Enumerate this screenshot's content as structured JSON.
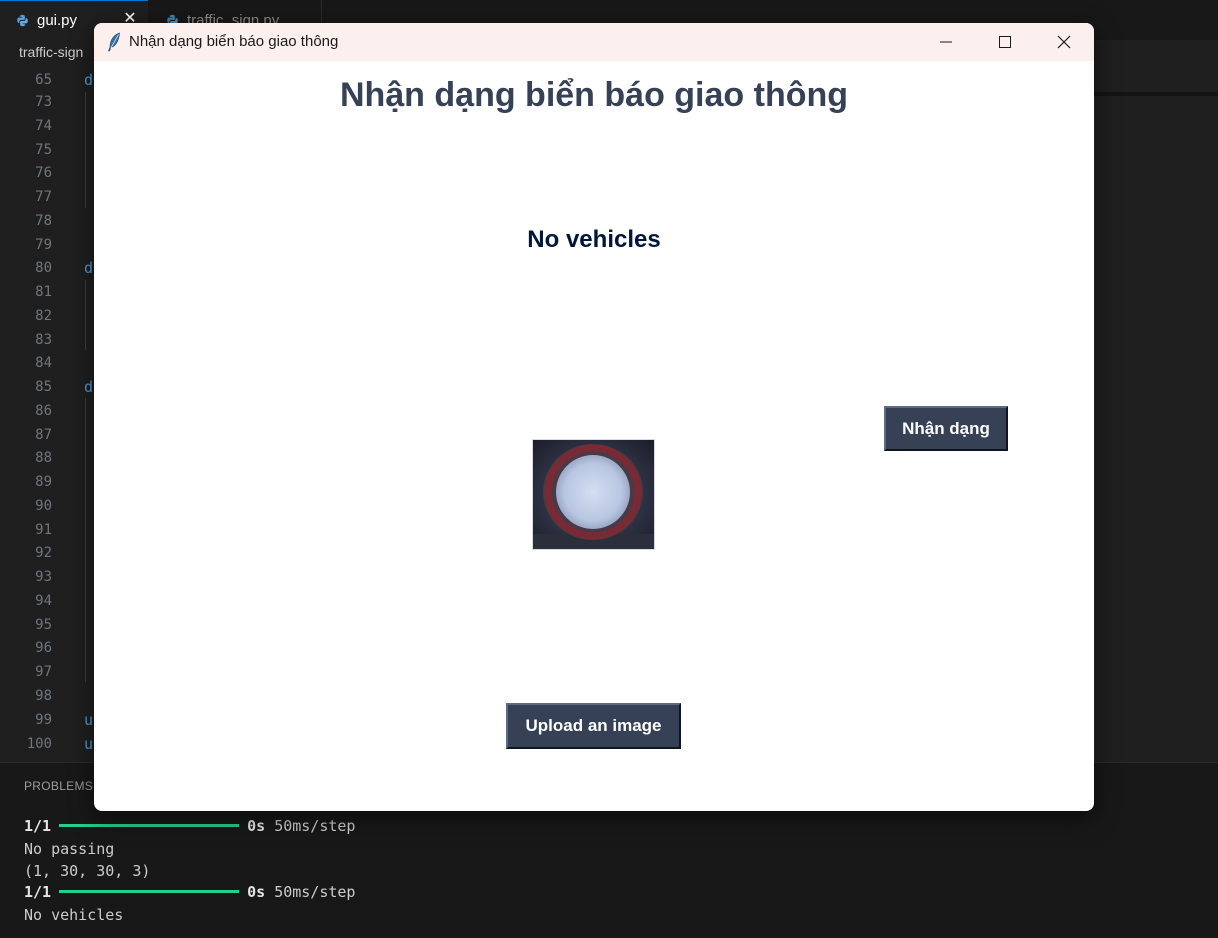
{
  "vscode": {
    "tabs": [
      {
        "label": "gui.py",
        "active": true
      },
      {
        "label": "traffic_sign.py",
        "active": false
      }
    ],
    "breadcrumb": "traffic-sign",
    "line_numbers": [
      "65",
      "73",
      "74",
      "75",
      "76",
      "77",
      "78",
      "79",
      "80",
      "81",
      "82",
      "83",
      "84",
      "85",
      "86",
      "87",
      "88",
      "89",
      "90",
      "91",
      "92",
      "93",
      "94",
      "95",
      "96",
      "97",
      "98",
      "99",
      "100"
    ],
    "code_fragments": [
      {
        "line": "65",
        "text": "d"
      },
      {
        "line": "80",
        "text": "d"
      },
      {
        "line": "85",
        "text": "d"
      },
      {
        "line": "99",
        "text": "u"
      },
      {
        "line": "100",
        "text": "u"
      }
    ],
    "panel": {
      "title": "PROBLEMS",
      "terminal": {
        "step1_count": "1/1",
        "step1_time": "0s",
        "step1_rate": "50ms/step",
        "output1": "No passing",
        "shape": "(1, 30, 30, 3)",
        "step2_count": "1/1",
        "step2_time": "0s",
        "step2_rate": "50ms/step",
        "output2": "No vehicles"
      }
    }
  },
  "tk_window": {
    "title": "Nhận dạng biển báo giao thông",
    "controls": {
      "minimize_icon": "minimize-icon",
      "maximize_icon": "maximize-icon",
      "close_icon": "close-icon"
    },
    "heading": "Nhận dạng biển báo giao thông",
    "result_label": "No vehicles",
    "classify_button": "Nhận dạng",
    "upload_button": "Upload an image",
    "colors": {
      "heading": "#364156",
      "result": "#011638",
      "button_bg": "#364156",
      "button_fg": "#ffffff"
    }
  }
}
